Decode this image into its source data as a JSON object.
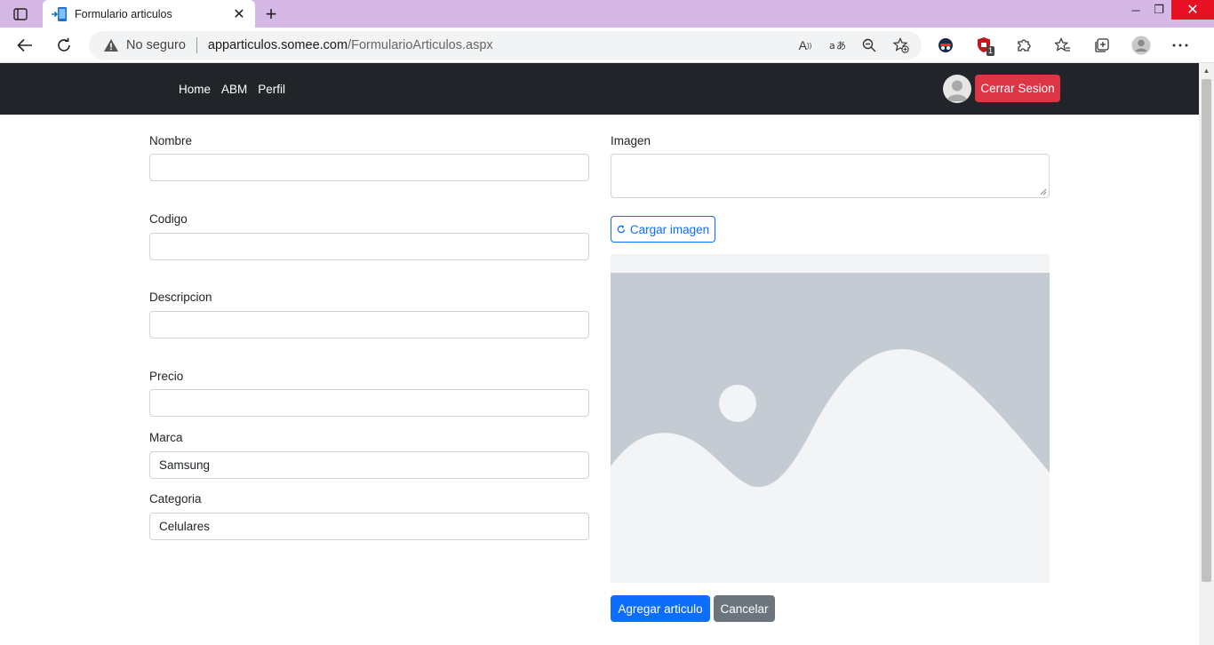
{
  "browser": {
    "tab_title": "Formulario articulos",
    "security_label": "No seguro",
    "url_host": "apparticulos.somee.com",
    "url_path": "/FormularioArticulos.aspx",
    "window_controls": {
      "minimize": "─",
      "maximize": "❐",
      "close": "✕"
    },
    "extension_badge": "1"
  },
  "navbar": {
    "links": [
      "Home",
      "ABM",
      "Perfil"
    ],
    "logout_label": "Cerrar Sesion"
  },
  "form": {
    "nombre": {
      "label": "Nombre",
      "value": ""
    },
    "codigo": {
      "label": "Codigo",
      "value": ""
    },
    "descripcion": {
      "label": "Descripcion",
      "value": ""
    },
    "precio": {
      "label": "Precio",
      "value": ""
    },
    "marca": {
      "label": "Marca",
      "value": "Samsung"
    },
    "categoria": {
      "label": "Categoria",
      "value": "Celulares"
    },
    "imagen": {
      "label": "Imagen",
      "value": ""
    },
    "load_image_label": "Cargar imagen",
    "submit_label": "Agregar articulo",
    "cancel_label": "Cancelar"
  },
  "colors": {
    "navbar_bg": "#212529",
    "danger": "#dc3545",
    "primary": "#0d6efd",
    "secondary": "#6c757d",
    "tab_strip": "#d5b8e6"
  }
}
